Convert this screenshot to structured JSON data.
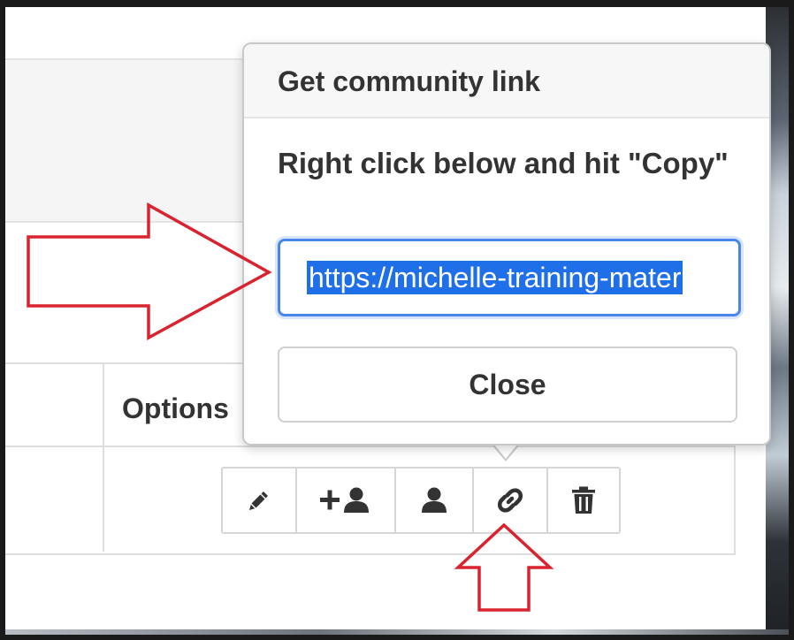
{
  "popover": {
    "title": "Get community link",
    "instruction": "Right click below and hit \"Copy\"",
    "link_value": "https://michelle-training-mater",
    "close_label": "Close"
  },
  "table": {
    "options_header": "Options"
  },
  "actions": [
    {
      "name": "edit",
      "icon": "pencil-icon"
    },
    {
      "name": "add-member",
      "icon": "add-user-icon"
    },
    {
      "name": "member",
      "icon": "user-icon"
    },
    {
      "name": "get-link",
      "icon": "link-icon"
    },
    {
      "name": "delete",
      "icon": "trash-icon"
    }
  ],
  "colors": {
    "annotation_arrow": "#d9232e",
    "input_focus": "#4a86e8",
    "selection": "#1f6fe8",
    "text": "#333333"
  }
}
